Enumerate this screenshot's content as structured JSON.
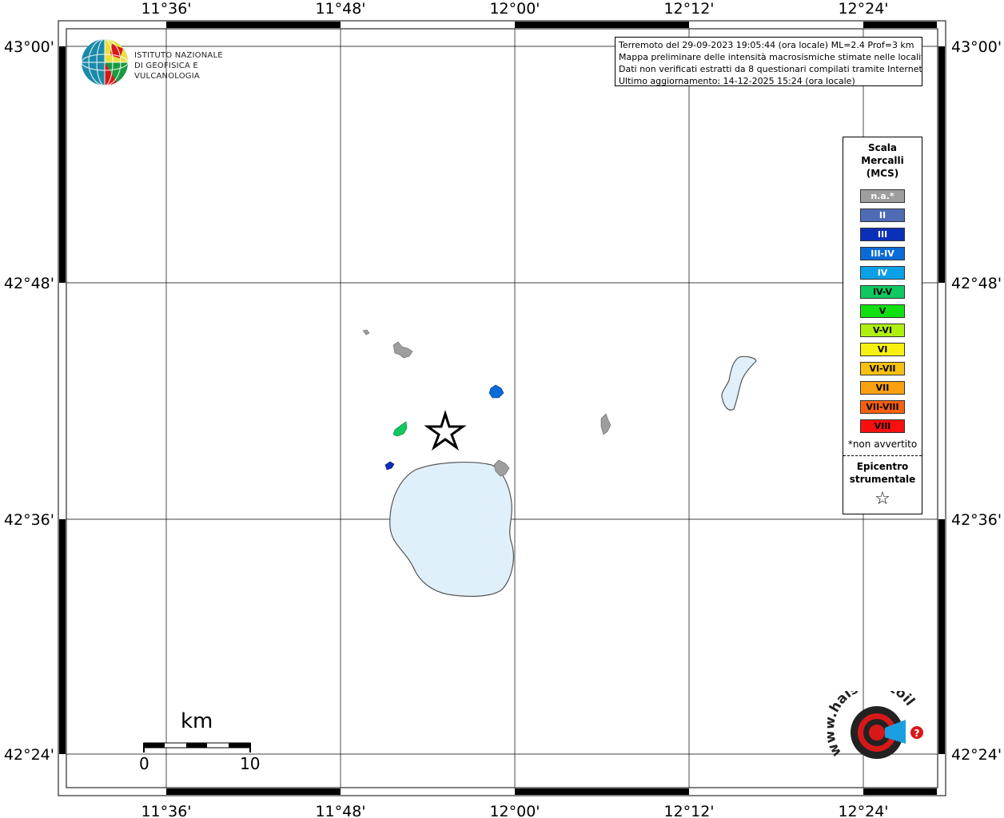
{
  "map": {
    "longitude_labels": [
      "11°36'",
      "11°48'",
      "12°00'",
      "12°12'",
      "12°24'"
    ],
    "latitude_labels": [
      "43°00'",
      "42°48'",
      "42°36'",
      "42°24'"
    ],
    "epicenter_icon": "star-icon",
    "water_color": "#dff0fb",
    "land_color": "#ffffff"
  },
  "institute": {
    "line1": "ISTITUTO NAZIONALE",
    "line2": "DI GEOFISICA E VULCANOLOGIA"
  },
  "info": {
    "line1": "Terremoto del 29-09-2023 19:05:44 (ora locale) ML=2.4 Prof=3 km",
    "line2": "Mappa preliminare delle intensità macrosismiche stimate nelle località",
    "line3": "Dati non verificati estratti da 8 questionari compilati tramite Internet.",
    "line4": "Ultimo aggiornamento: 14-12-2025 15:24 (ora locale)"
  },
  "legend": {
    "title_line1": "Scala",
    "title_line2": "Mercalli",
    "title_line3": "(MCS)",
    "items": [
      {
        "label": "n.a.*",
        "color": "#9e9e9e",
        "text_color": "#ffffff"
      },
      {
        "label": "II",
        "color": "#4f6bb5",
        "text_color": "#ffffff"
      },
      {
        "label": "III",
        "color": "#0a2fb8",
        "text_color": "#ffffff"
      },
      {
        "label": "III-IV",
        "color": "#0a6bd6",
        "text_color": "#ffffff"
      },
      {
        "label": "IV",
        "color": "#0aa0e8",
        "text_color": "#ffffff"
      },
      {
        "label": "IV-V",
        "color": "#10c860",
        "text_color": "#000000"
      },
      {
        "label": "V",
        "color": "#10e010",
        "text_color": "#000000"
      },
      {
        "label": "V-VI",
        "color": "#b0f010",
        "text_color": "#000000"
      },
      {
        "label": "VI",
        "color": "#f8f010",
        "text_color": "#000000"
      },
      {
        "label": "VI-VII",
        "color": "#f8c010",
        "text_color": "#000000"
      },
      {
        "label": "VII",
        "color": "#f8a010",
        "text_color": "#000000"
      },
      {
        "label": "VII-VIII",
        "color": "#f86010",
        "text_color": "#000000"
      },
      {
        "label": "VIII",
        "color": "#f81010",
        "text_color": "#000000"
      }
    ],
    "note": "*non avvertito",
    "epicenter_line1": "Epicentro",
    "epicenter_line2": "strumentale"
  },
  "scale_bar": {
    "unit": "km",
    "start": "0",
    "end": "10"
  },
  "watermark": {
    "text": "www.haisentitoilterremoto.it"
  }
}
